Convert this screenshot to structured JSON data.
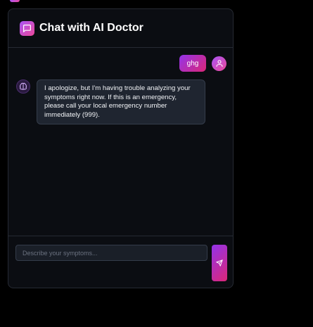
{
  "header": {
    "title": "Chat with AI Doctor",
    "icon": "message-square-icon"
  },
  "messages": [
    {
      "role": "user",
      "text": "ghg",
      "icon": "user-icon"
    },
    {
      "role": "assistant",
      "text": "I apologize, but I'm having trouble analyzing your symptoms right now. If this is an emergency, please call your local emergency number immediately (999).",
      "icon": "brain-icon"
    }
  ],
  "composer": {
    "placeholder": "Describe your symptoms...",
    "value": "",
    "send_icon": "send-icon"
  },
  "colors": {
    "accent_start": "#a855f7",
    "accent_end": "#ec4899",
    "panel_bg": "#0b0d12",
    "bubble_bg": "#1f2530"
  }
}
